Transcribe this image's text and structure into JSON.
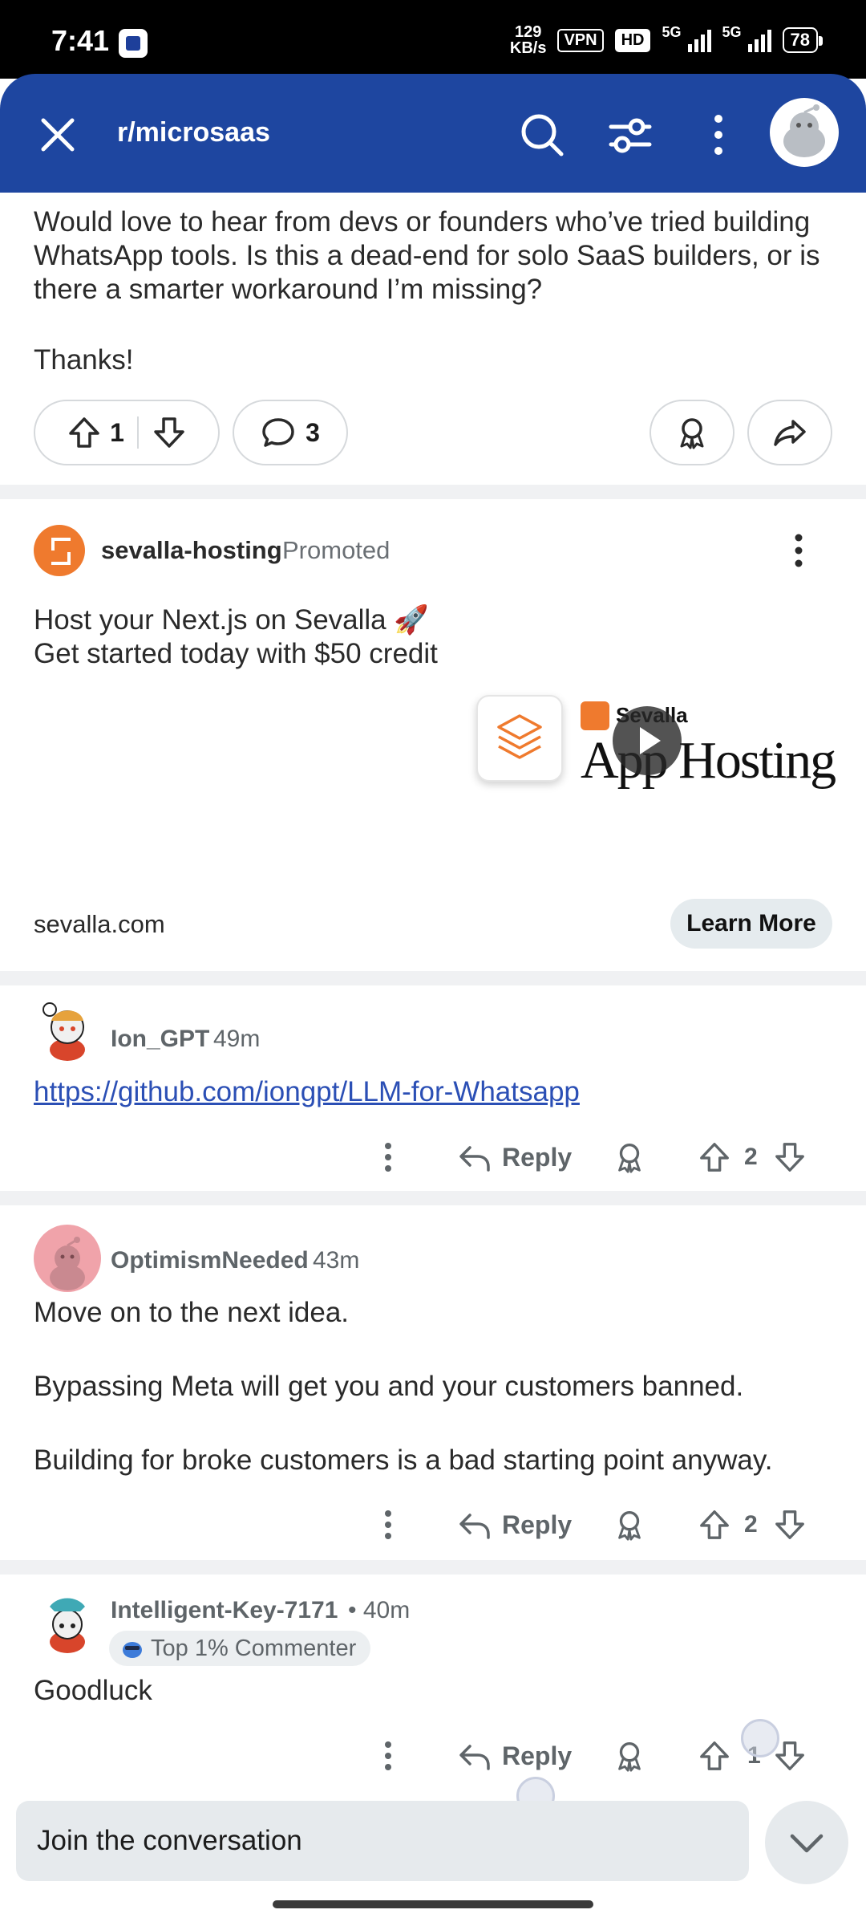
{
  "status_bar": {
    "time": "7:41",
    "speed_value": "129",
    "speed_unit": "KB/s",
    "vpn": "VPN",
    "hd": "HD",
    "net1": "5G",
    "net2": "5G",
    "battery": "78"
  },
  "header": {
    "title": "r/microsaas"
  },
  "post": {
    "body": "Would love to hear from devs or founders who’ve tried building WhatsApp tools. Is this a dead-end for solo SaaS builders, or is there a smarter workaround I’m missing?",
    "closing": "Thanks!",
    "upvotes": "1",
    "comments": "3"
  },
  "ad": {
    "author": "sevalla-hosting",
    "promoted_label": "Promoted",
    "text": "Host your Next.js on Sevalla 🚀 Get started today with $50 credit",
    "image_brand": "Sevalla",
    "image_headline": "App Hosting",
    "domain": "sevalla.com",
    "cta": "Learn More",
    "brand_color": "#ef7a2e"
  },
  "comments": [
    {
      "author": "Ion_GPT",
      "time": "49m",
      "link": "https://github.com/iongpt/LLM-for-Whatsapp",
      "reply_label": "Reply",
      "votes": "2"
    },
    {
      "author": "OptimismNeeded",
      "time": "43m",
      "paragraphs": [
        "Move on to the next idea.",
        "Bypassing Meta will get you and your customers banned.",
        "Building for broke customers is a bad starting point anyway."
      ],
      "reply_label": "Reply",
      "votes": "2"
    },
    {
      "author": "Intelligent-Key-7171",
      "time": "• 40m",
      "flair": "Top 1% Commenter",
      "body": "Goodluck",
      "reply_label": "Reply",
      "votes": "1"
    }
  ],
  "composer": {
    "placeholder": "Join the conversation"
  },
  "colors": {
    "header_bg": "#1e46a0",
    "link": "#2b4fb5"
  }
}
